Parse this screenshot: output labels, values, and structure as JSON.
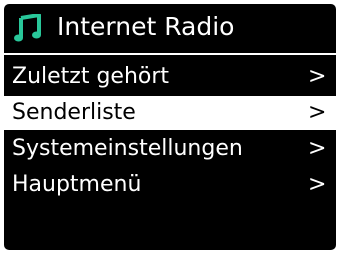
{
  "header": {
    "title": "Internet Radio",
    "icon": "music-note-icon",
    "icon_color": "#29c79a"
  },
  "menu": {
    "items": [
      {
        "label": "Zuletzt gehört",
        "arrow": ">",
        "selected": false
      },
      {
        "label": "Senderliste",
        "arrow": ">",
        "selected": true
      },
      {
        "label": "Systemeinstellungen",
        "arrow": ">",
        "selected": false
      },
      {
        "label": "Hauptmenü",
        "arrow": ">",
        "selected": false
      }
    ]
  },
  "colors": {
    "screen_background": "#000000",
    "text": "#ffffff",
    "highlight_background": "#ffffff",
    "highlight_text": "#000000",
    "accent": "#29c79a"
  }
}
